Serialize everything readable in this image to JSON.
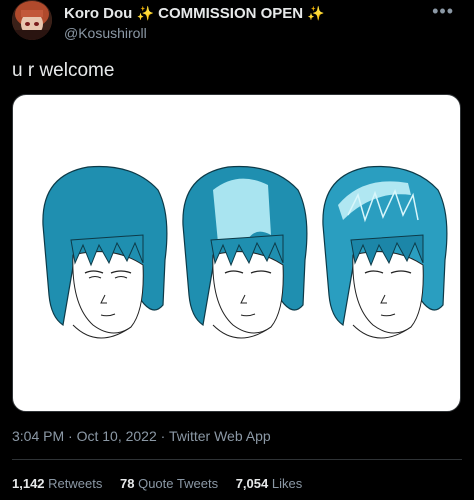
{
  "tweet": {
    "author_name": "Koro Dou",
    "sparkle_left": "✨",
    "author_title": "COMMISSION OPEN",
    "sparkle_right": "✨",
    "handle": "@Kosushiroll",
    "more_icon": "more-icon",
    "text": "u r welcome",
    "time": "3:04 PM",
    "date": "Oct 10, 2022",
    "source": "Twitter Web App",
    "separator": "·"
  },
  "stats": {
    "retweets_count": "1,142",
    "retweets_label": "Retweets",
    "quotes_count": "78",
    "quotes_label": "Quote Tweets",
    "likes_count": "7,054",
    "likes_label": "Likes"
  },
  "colors": {
    "background": "#000000",
    "text": "#e7e9ea",
    "secondary": "#8b98a5",
    "hair_teal": "#1f8fb0",
    "hair_highlight": "#a9e4f0"
  }
}
